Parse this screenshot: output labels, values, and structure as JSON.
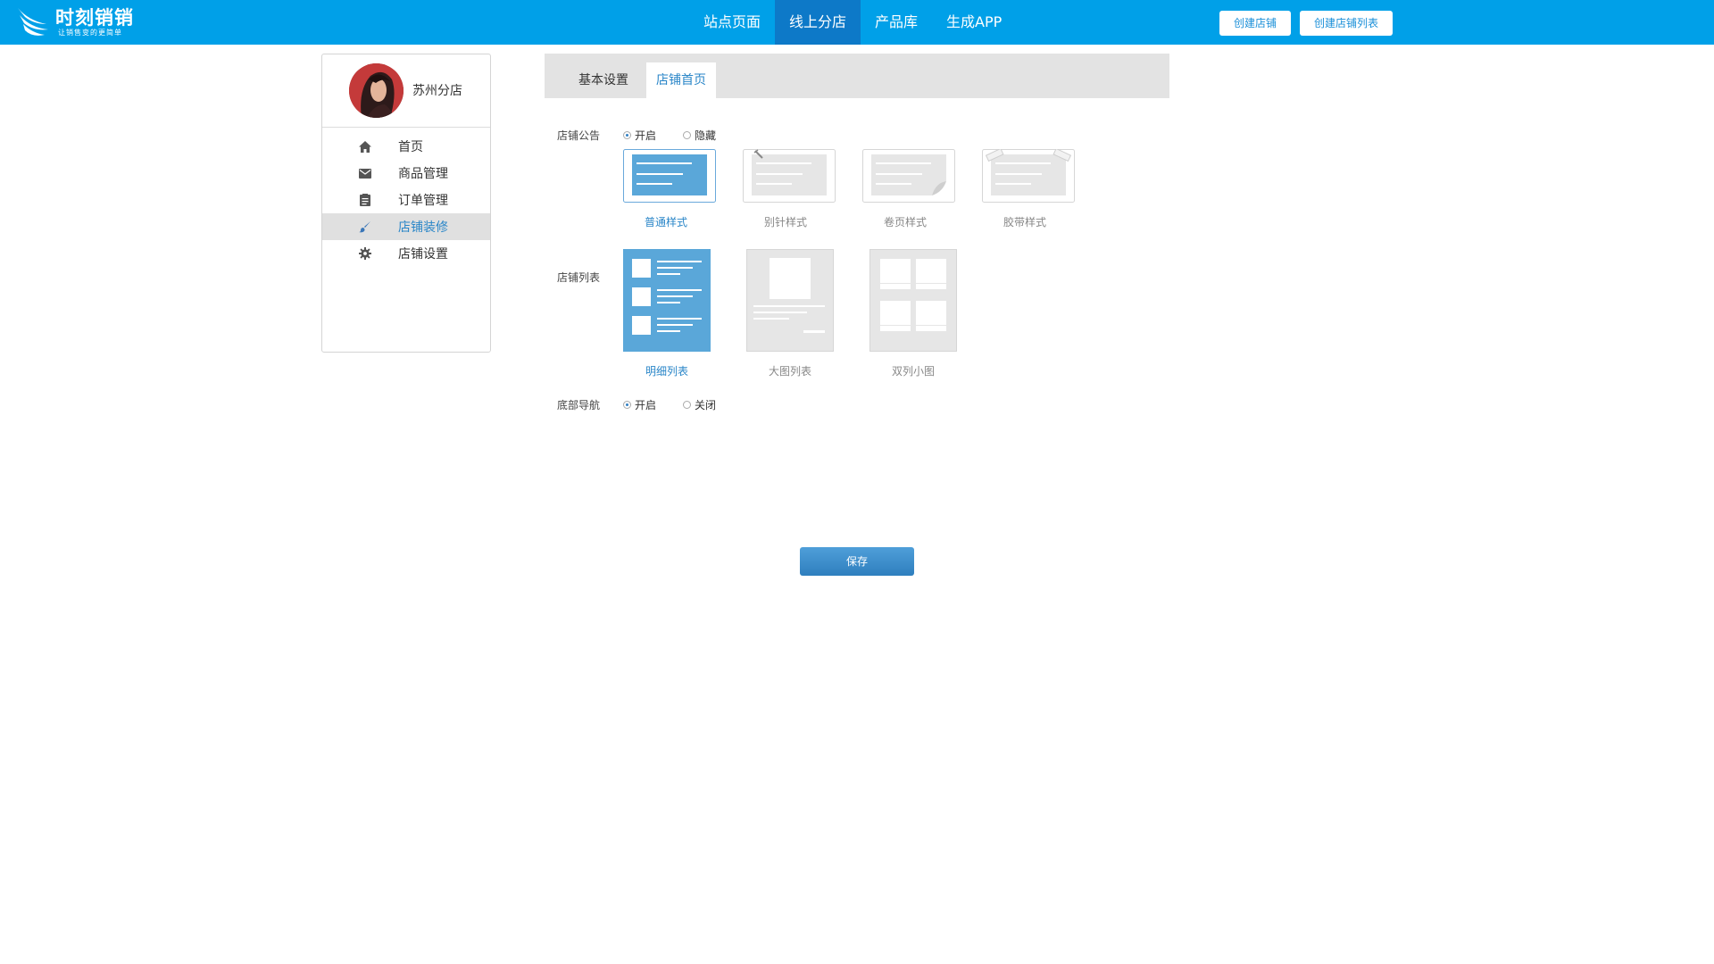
{
  "brand": {
    "name": "时刻销销",
    "slogan": "让销售变的更简单"
  },
  "nav": {
    "items": [
      {
        "label": "站点页面",
        "active": false
      },
      {
        "label": "线上分店",
        "active": true
      },
      {
        "label": "产品库",
        "active": false
      },
      {
        "label": "生成APP",
        "active": false
      }
    ],
    "create_store": "创建店铺",
    "create_store_list": "创建店铺列表"
  },
  "sidebar": {
    "store_name": "苏州分店",
    "items": [
      {
        "label": "首页",
        "icon": "home-icon",
        "active": false
      },
      {
        "label": "商品管理",
        "icon": "envelope-icon",
        "active": false
      },
      {
        "label": "订单管理",
        "icon": "clipboard-icon",
        "active": false
      },
      {
        "label": "店铺装修",
        "icon": "brush-icon",
        "active": true
      },
      {
        "label": "店铺设置",
        "icon": "gear-icon",
        "active": false
      }
    ]
  },
  "tabs": [
    {
      "label": "基本设置",
      "active": false
    },
    {
      "label": "店铺首页",
      "active": true
    }
  ],
  "announcement": {
    "label": "店铺公告",
    "options": [
      {
        "label": "开启",
        "checked": true
      },
      {
        "label": "隐藏",
        "checked": false
      }
    ],
    "styles": [
      {
        "label": "普通样式",
        "selected": true
      },
      {
        "label": "别针样式",
        "selected": false
      },
      {
        "label": "卷页样式",
        "selected": false
      },
      {
        "label": "胶带样式",
        "selected": false
      }
    ]
  },
  "store_list": {
    "label": "店铺列表",
    "layouts": [
      {
        "label": "明细列表",
        "selected": true
      },
      {
        "label": "大图列表",
        "selected": false
      },
      {
        "label": "双列小图",
        "selected": false
      }
    ]
  },
  "bottom_nav": {
    "label": "底部导航",
    "options": [
      {
        "label": "开启",
        "checked": true
      },
      {
        "label": "关闭",
        "checked": false
      }
    ]
  },
  "save_label": "保存",
  "colors": {
    "topbar": "#00a0e8",
    "nav_active": "#0d79c8",
    "accent": "#2a86c8",
    "selected_card": "#5aa7d9"
  }
}
